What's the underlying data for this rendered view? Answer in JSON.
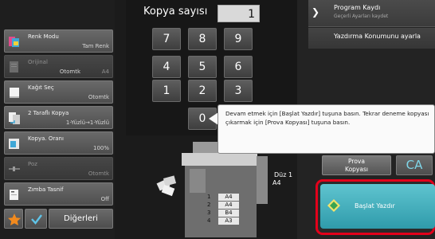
{
  "left_panel": {
    "settings": [
      {
        "label": "Renk Modu",
        "value": "Tam Renk",
        "icon": "color-mode-icon",
        "state": "active"
      },
      {
        "label": "Orijinal",
        "value_left": "Otomtk",
        "value": "A4",
        "icon": "original-icon",
        "state": "disabled"
      },
      {
        "label": "Kağıt Seç",
        "value": "Otomtk",
        "icon": "paper-select-icon",
        "state": "active"
      },
      {
        "label": "2 Taraflı Kopya",
        "value": "1-Yüzlü→1-Yüzlü",
        "icon": "duplex-copy-icon",
        "state": "active"
      },
      {
        "label": "Kopya. Oranı",
        "value": "100%",
        "icon": "copy-ratio-icon",
        "state": "active"
      },
      {
        "label": "Poz",
        "value": "Otomtk",
        "icon": "exposure-icon",
        "state": "disabled"
      },
      {
        "label": "Zımba Tasnif",
        "value": "Off",
        "icon": "staple-sort-icon",
        "state": "active"
      }
    ],
    "bottom_bar": {
      "star_icon": "star-icon",
      "check_icon": "check-icon",
      "others_label": "Diğerleri"
    }
  },
  "keypad": {
    "label": "Kopya sayısı",
    "value": "1",
    "keys": [
      "7",
      "8",
      "9",
      "4",
      "5",
      "6",
      "1",
      "2",
      "3",
      "0"
    ]
  },
  "right_panel": {
    "program": {
      "title": "Program Kaydı",
      "subtitle": "Geçerli Ayarları kaydet",
      "icon": "chevron-right-icon"
    },
    "location_label": "Yazdırma Konumunu ayarla"
  },
  "tooltip": {
    "text": "Devam etmek için [Başlat Yazdır] tuşuna basın. Tekrar deneme kopyası çıkarmak için [Prova Kopyası] tuşuna basın."
  },
  "actions": {
    "proof_label_line1": "Prova",
    "proof_label_line2": "Kopyası",
    "color_label": "CA",
    "start_label": "Başlat Yazdır",
    "start_icon": "start-diamond-icon"
  },
  "machine": {
    "original_label": "Düz 1",
    "original_size": "A4",
    "trays": [
      {
        "num": "1",
        "size": "A4"
      },
      {
        "num": "2",
        "size": "A4"
      },
      {
        "num": "3",
        "size": "B4"
      },
      {
        "num": "4",
        "size": "A3"
      }
    ]
  },
  "colors": {
    "start_button": "#3fb0bf",
    "highlight_frame": "#e3001b",
    "background": "#1b1b1b"
  }
}
